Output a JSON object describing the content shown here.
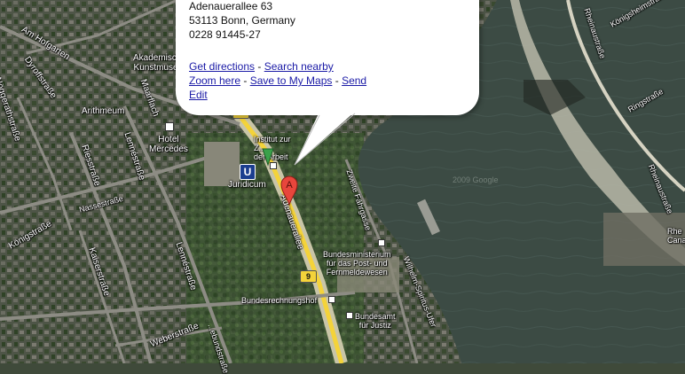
{
  "map": {
    "street_labels": [
      {
        "id": "am-hofgarten",
        "text": "Am Hofgarten"
      },
      {
        "id": "dyroffstrasse",
        "text": "Dyroffstraße"
      },
      {
        "id": "noeggerathstrasse",
        "text": "Nöggerathstraße"
      },
      {
        "id": "arithmeum",
        "text": "Arithmeum"
      },
      {
        "id": "akademisches-kunstmuseum",
        "text": "Akademisches\nKunstmuseum"
      },
      {
        "id": "maarflach",
        "text": "Maarflach"
      },
      {
        "id": "hotel-mercedes",
        "text": "Hotel\nMercedes"
      },
      {
        "id": "riessstrasse",
        "text": "Riesstraße"
      },
      {
        "id": "lennestrasse-1",
        "text": "Lennéstraße"
      },
      {
        "id": "lennestrasse-2",
        "text": "Lennéstraße"
      },
      {
        "id": "koenigstrasse",
        "text": "Königstraße"
      },
      {
        "id": "nassestrasse",
        "text": "Nassestraße"
      },
      {
        "id": "kaiserstrasse",
        "text": "Kaiserstraße"
      },
      {
        "id": "weberstrasse",
        "text": "Weberstraße"
      },
      {
        "id": "juridicum",
        "text": "Juridicum"
      },
      {
        "id": "institut",
        "text": "Institut zur\nZ...\nder Arbeit"
      },
      {
        "id": "adenauerallee",
        "text": "Adenauerallee"
      },
      {
        "id": "zweite-faehrgasse",
        "text": "Zweite Fährgasse"
      },
      {
        "id": "bundesministerium",
        "text": "Bundesministerium\nfür das Post- und\nFernmeldewesen"
      },
      {
        "id": "bundesrechnungshof",
        "text": "Bundesrechnungshof"
      },
      {
        "id": "bundesamt",
        "text": "Bundesamt\nfür Justiz"
      },
      {
        "id": "wilhelm-spiritus-ufer",
        "text": "Wilhelm-Spiritus-Ufer"
      },
      {
        "id": "rheinaustrasse",
        "text": "Rheinaustraße"
      },
      {
        "id": "ringstrasse",
        "text": "Ringstraße"
      },
      {
        "id": "koenigsheimstrasse",
        "text": "Königsheimstraße"
      },
      {
        "id": "rheinaustrasse-2",
        "text": "Rheinaustraße"
      },
      {
        "id": "bundesstrasse",
        "text": "...ebundstraße"
      },
      {
        "id": "cana",
        "text": "Rhe\nCana"
      }
    ],
    "route_shield": "9",
    "ubahn_label": "U",
    "marker_letter": "A",
    "watermark": "2009 Google",
    "colors": {
      "water": "#3c4b44",
      "route": "#f4d33a",
      "marker": "#e8463c",
      "ubahn": "#1b3e8f"
    }
  },
  "popup": {
    "address_line1": "Adenauerallee 63",
    "address_line2": "53113 Bonn, Germany",
    "phone": "0228 91445-27",
    "links": {
      "get_directions": "Get directions",
      "search_nearby": "Search nearby",
      "zoom_here": "Zoom here",
      "save_to_my_maps": "Save to My Maps",
      "send": "Send",
      "edit": "Edit"
    },
    "separator": " - "
  }
}
